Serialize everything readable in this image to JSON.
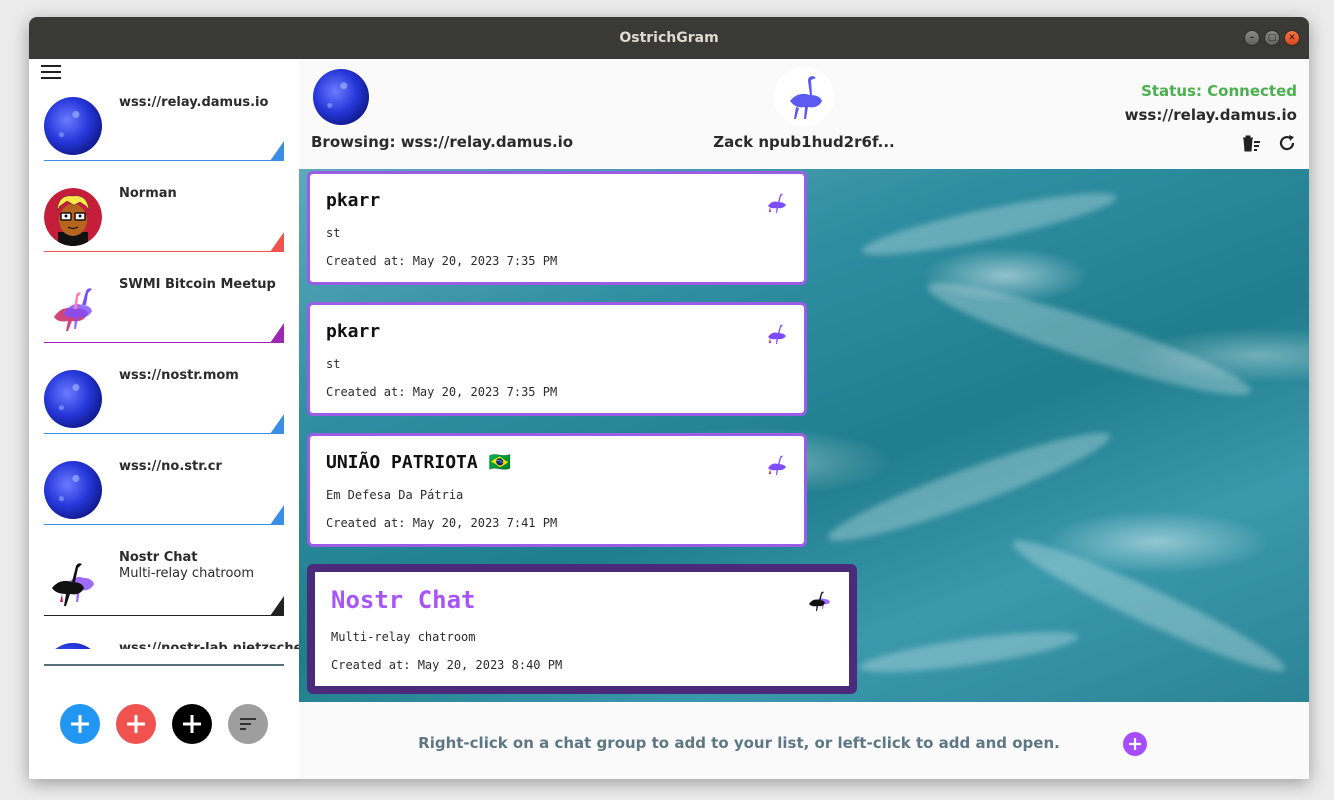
{
  "window": {
    "title": "OstrichGram"
  },
  "sidebar": {
    "items": [
      {
        "name": "wss://relay.damus.io",
        "sub": "",
        "avatar": "blue-globe",
        "accent": "#3a8ee6"
      },
      {
        "name": "Norman",
        "sub": "",
        "avatar": "cartoon-face",
        "accent": "#f0524f"
      },
      {
        "name": "SWMI Bitcoin Meetup",
        "sub": "",
        "avatar": "ostrich-colorful",
        "accent": "#9c27b0"
      },
      {
        "name": "wss://nostr.mom",
        "sub": "",
        "avatar": "blue-globe",
        "accent": "#3a8ee6"
      },
      {
        "name": "wss://no.str.cr",
        "sub": "",
        "avatar": "blue-globe",
        "accent": "#3a8ee6"
      },
      {
        "name": "Nostr Chat",
        "sub": "Multi-relay chatroom",
        "avatar": "ostrich-black",
        "accent": "#222222"
      },
      {
        "name": "wss://nostr-lab.nietzsche...",
        "sub": "",
        "avatar": "blue-globe",
        "accent": "#3a8ee6"
      }
    ],
    "fab_colors": [
      "#2196f3",
      "#f0524f",
      "#000000",
      "#9e9e9e"
    ]
  },
  "header": {
    "browsing": "Browsing: wss://relay.damus.io",
    "user": "Zack  npub1hud2r6f...",
    "status": "Status: Connected",
    "status_color": "#4caf50",
    "relay": "wss://relay.damus.io"
  },
  "feed": {
    "cards": [
      {
        "title": "pkarr",
        "about": "st",
        "created": "Created at: May 20, 2023 7:35 PM"
      },
      {
        "title": "pkarr",
        "about": "st",
        "created": "Created at: May 20, 2023 7:35 PM"
      },
      {
        "title": "UNIÃO PATRIOTA 🇧🇷",
        "about": "Em Defesa Da Pátria",
        "created": "Created at: May 20, 2023 7:41 PM"
      },
      {
        "title": "Nostr Chat",
        "about": "Multi-relay chatroom",
        "created": "Created at: May 20, 2023 8:40 PM",
        "highlighted": true
      }
    ],
    "card_border": "#9b5de5",
    "highlight_border": "#4a2a7a",
    "highlight_title_color": "#a855f7"
  },
  "footer": {
    "hint": "Right-click on a chat group to add to your list, or left-click to add and open.",
    "add_color": "#a54dff"
  }
}
